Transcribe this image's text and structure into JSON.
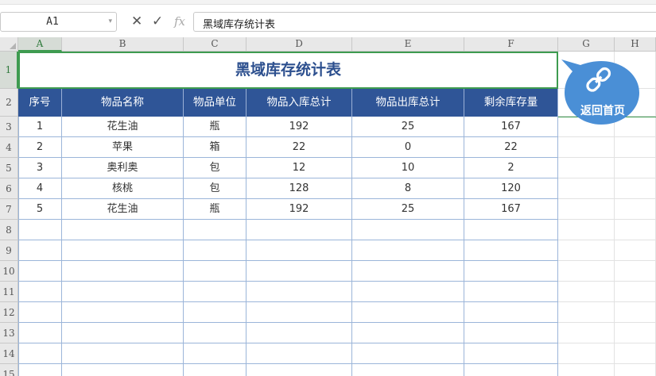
{
  "formula_bar": {
    "name_box": "A1",
    "cancel_icon": "✕",
    "enter_icon": "✓",
    "fx_label": "fx",
    "formula": "黑域库存统计表"
  },
  "columns": [
    "A",
    "B",
    "C",
    "D",
    "E",
    "F",
    "G",
    "H"
  ],
  "rows": [
    "1",
    "2",
    "3",
    "4",
    "5",
    "6",
    "7",
    "8",
    "9",
    "10",
    "11",
    "12",
    "13",
    "14",
    "15"
  ],
  "table": {
    "title": "黑域库存统计表",
    "headers": [
      "序号",
      "物品名称",
      "物品单位",
      "物品入库总计",
      "物品出库总计",
      "剩余库存量"
    ],
    "rows": [
      [
        "1",
        "花生油",
        "瓶",
        "192",
        "25",
        "167"
      ],
      [
        "2",
        "苹果",
        "箱",
        "22",
        "0",
        "22"
      ],
      [
        "3",
        "奥利奥",
        "包",
        "12",
        "10",
        "2"
      ],
      [
        "4",
        "核桃",
        "包",
        "128",
        "8",
        "120"
      ],
      [
        "5",
        "花生油",
        "瓶",
        "192",
        "25",
        "167"
      ]
    ]
  },
  "home_button": {
    "label": "返回首页",
    "icon": "link-icon"
  },
  "colors": {
    "header_bg": "#2f5597",
    "title_text": "#2c4f8e",
    "selection": "#3e9b50",
    "home_bg": "#4a8fd6"
  }
}
